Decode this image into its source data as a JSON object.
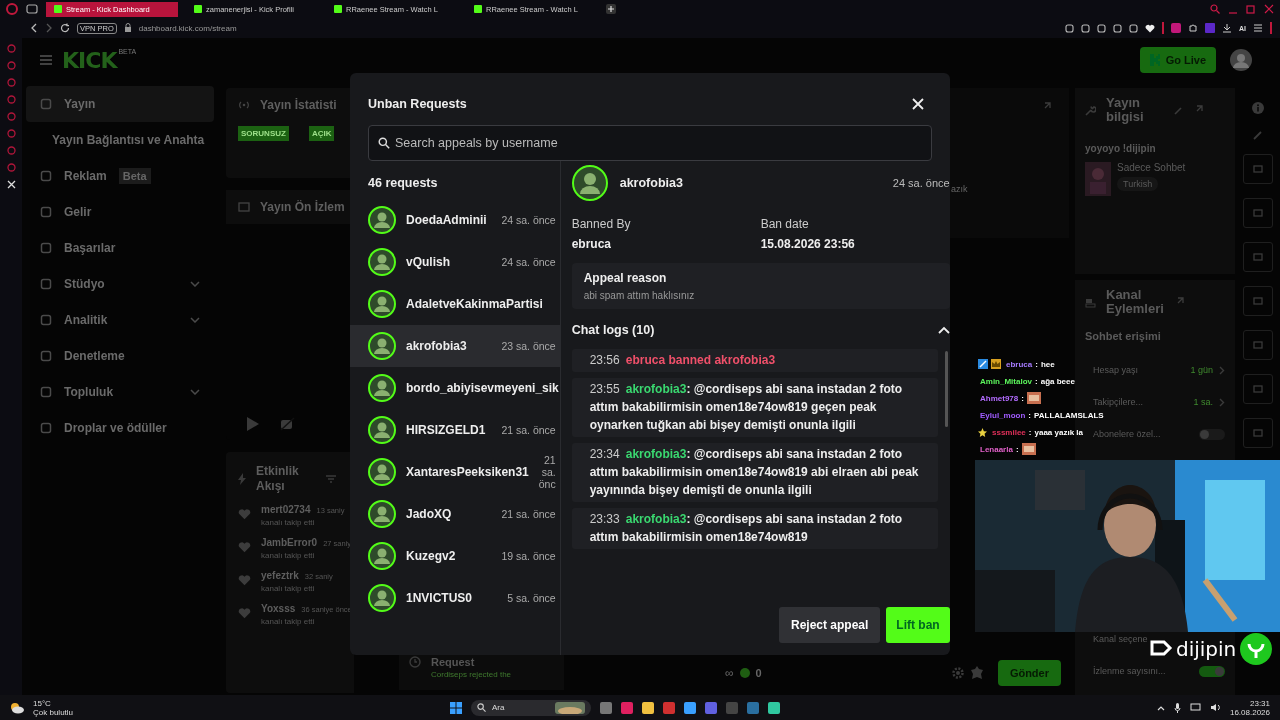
{
  "browser": {
    "tabs": [
      {
        "label": "Stream - Kick Dashboard",
        "selected": true
      },
      {
        "label": "zamanenerjisi - Kick Profili",
        "selected": false
      },
      {
        "label": "RRaenee Stream - Watch L",
        "selected": false
      },
      {
        "label": "RRaenee Stream - Watch L",
        "selected": false
      }
    ],
    "vpn_badge": "VPN PRO",
    "url": "dashboard.kick.com/stream",
    "ai_label": "AI"
  },
  "header": {
    "logo": "KICK",
    "logo_badge": "BETA",
    "go_live": "Go Live"
  },
  "sidebar": {
    "items": [
      {
        "label": "Yayın",
        "selected": true,
        "expandable": false
      },
      {
        "label": "Yayın Bağlantısı ve Anahta",
        "selected": false,
        "expandable": false
      },
      {
        "label": "Reklam",
        "badge": "Beta",
        "selected": false,
        "expandable": false
      },
      {
        "label": "Gelir",
        "selected": false,
        "expandable": false
      },
      {
        "label": "Başarılar",
        "selected": false,
        "expandable": false
      },
      {
        "label": "Stüdyo",
        "selected": false,
        "expandable": true
      },
      {
        "label": "Analitik",
        "selected": false,
        "expandable": true
      },
      {
        "label": "Denetleme",
        "selected": false,
        "expandable": false
      },
      {
        "label": "Topluluk",
        "selected": false,
        "expandable": true
      },
      {
        "label": "Droplar ve ödüller",
        "selected": false,
        "expandable": false
      }
    ]
  },
  "stats_card": {
    "title": "Yayın İstatisti",
    "badges": [
      "SORUNSUZ",
      "AÇIK"
    ]
  },
  "preview_card": {
    "title": "Yayın Ön İzlem"
  },
  "activity": {
    "title": "Etkinlik Akışı",
    "events": [
      {
        "user": "mert02734",
        "time": "13 saniy",
        "action": "kanalı takip etti"
      },
      {
        "user": "JambError0",
        "time": "27 saniy",
        "action": "kanalı takip etti"
      },
      {
        "user": "yefeztrk",
        "time": "32 saniy",
        "action": "kanalı takip etti"
      },
      {
        "user": "Yoxsss",
        "time": "36 saniye önce",
        "action": "kanalı takip etti"
      }
    ]
  },
  "side_panel": {
    "text": "azık"
  },
  "bottom_strip": {
    "request_title": "Request",
    "request_text": "Cordiseps rejected the",
    "counter_symbol": "∞",
    "counter_value": "0",
    "send_button": "Gönder"
  },
  "stream_info": {
    "title": "Yayın bilgisi",
    "stream_title": "yoyoyo !dijipin",
    "category": "Sadece Sohbet",
    "tag": "Turkish"
  },
  "channel_actions": {
    "title": "Kanal Eylemleri",
    "section": "Sohbet erişimi",
    "rows": [
      {
        "kind": "value",
        "label": "Hesap yaşı",
        "value": "1 gün"
      },
      {
        "kind": "value",
        "label": "Takipçilere...",
        "value": "1 sa."
      },
      {
        "kind": "toggle",
        "label": "Abonelere özel...",
        "on": false
      }
    ],
    "lower_rows": [
      {
        "kind": "text",
        "label": "Kanal seçene"
      },
      {
        "kind": "toggle",
        "label": "İzlenme sayısını...",
        "on": true
      }
    ]
  },
  "modal": {
    "title": "Unban Requests",
    "search": {
      "placeholder": "Search appeals by username"
    },
    "count": "46 requests",
    "requests": [
      {
        "name": "DoedaAdminii",
        "time": "24 sa. önce",
        "selected": false
      },
      {
        "name": "vQulish",
        "time": "24 sa. önce",
        "selected": false
      },
      {
        "name": "AdaletveKakinmaPartisi",
        "selected": false
      },
      {
        "name": "akrofobia3",
        "time": "23 sa. önce",
        "selected": true
      },
      {
        "name": "bordo_abiyisevmeyeni_sik",
        "selected": false
      },
      {
        "name": "HIRSIZGELD1",
        "time": "21 sa. önce",
        "selected": false
      },
      {
        "name": "XantaresPeeksiken31",
        "time": "21 sa. önc",
        "selected": false
      },
      {
        "name": "JadoXQ",
        "time": "21 sa. önce",
        "selected": false
      },
      {
        "name": "Kuzegv2",
        "time": "19 sa. önce",
        "selected": false
      },
      {
        "name": "1NVICTUS0",
        "time": "5 sa. önce",
        "selected": false
      }
    ],
    "detail": {
      "user": "akrofobia3",
      "time": "24 sa. önce",
      "banned_by_label": "Banned By",
      "banned_by": "ebruca",
      "ban_date_label": "Ban date",
      "ban_date": "15.08.2026 23:56",
      "appeal_label": "Appeal reason",
      "appeal_text": "abi spam attım haklısınız",
      "logs_title": "Chat logs (10)",
      "logs_expanded": true,
      "logs": [
        {
          "kind": "ban",
          "time": "23:56",
          "text": "ebruca banned akrofobia3"
        },
        {
          "kind": "message",
          "time": "23:55",
          "user": "akrofobia3",
          "separator": ":",
          "text": "@cordiseps abi sana instadan 2 foto attım bakabilirmisin omen18e74ow819 geçen peak oynarken tuğkan abi bişey demişti onunla ilgili"
        },
        {
          "kind": "message",
          "time": "23:34",
          "user": "akrofobia3",
          "separator": ":",
          "text": "@cordiseps abi sana instadan 2 foto attım bakabilirmisin omen18e74ow819 abi elraen abi peak yayınında bişey demişti de onunla ilgili"
        },
        {
          "kind": "message",
          "time": "23:33",
          "user": "akrofobia3",
          "separator": ":",
          "text": "@cordiseps abi sana instadan 2 foto attım bakabilirmisin omen18e74ow819"
        }
      ]
    },
    "reject_button": "Reject appeal",
    "lift_button": "Lift ban"
  },
  "chat_overlay": [
    {
      "name": "ebruca",
      "color": "#a77cff",
      "badges": [
        {
          "kind": "moderator"
        },
        {
          "kind": "crown"
        }
      ],
      "separator": ":",
      "kind": "text",
      "text": "hee"
    },
    {
      "name": "Amin_Mitalov",
      "color": "#5cf75c",
      "separator": ":",
      "kind": "text",
      "text": "ağa beee"
    },
    {
      "name": "Ahmet978",
      "color": "#b36cff",
      "separator": ":",
      "kind": "emote"
    },
    {
      "name": "Eylul_moon",
      "color": "#a05cff",
      "separator": ":",
      "kind": "text",
      "text": "PALLALAMSLALS"
    },
    {
      "name": "sssmilee",
      "color": "#e0305a",
      "badges": [
        {
          "kind": "star"
        }
      ],
      "separator": ":",
      "kind": "text",
      "text": "yaaa yazık la"
    },
    {
      "name": "Lenaarla",
      "color": "#e060c8",
      "separator": ":",
      "kind": "emote"
    }
  ],
  "stream_logo": "dijipin",
  "taskbar": {
    "temperature": "15°C",
    "weather": "Çok bulutlu",
    "search": "Ara",
    "time": "23:31",
    "date": "16.08.2026"
  }
}
